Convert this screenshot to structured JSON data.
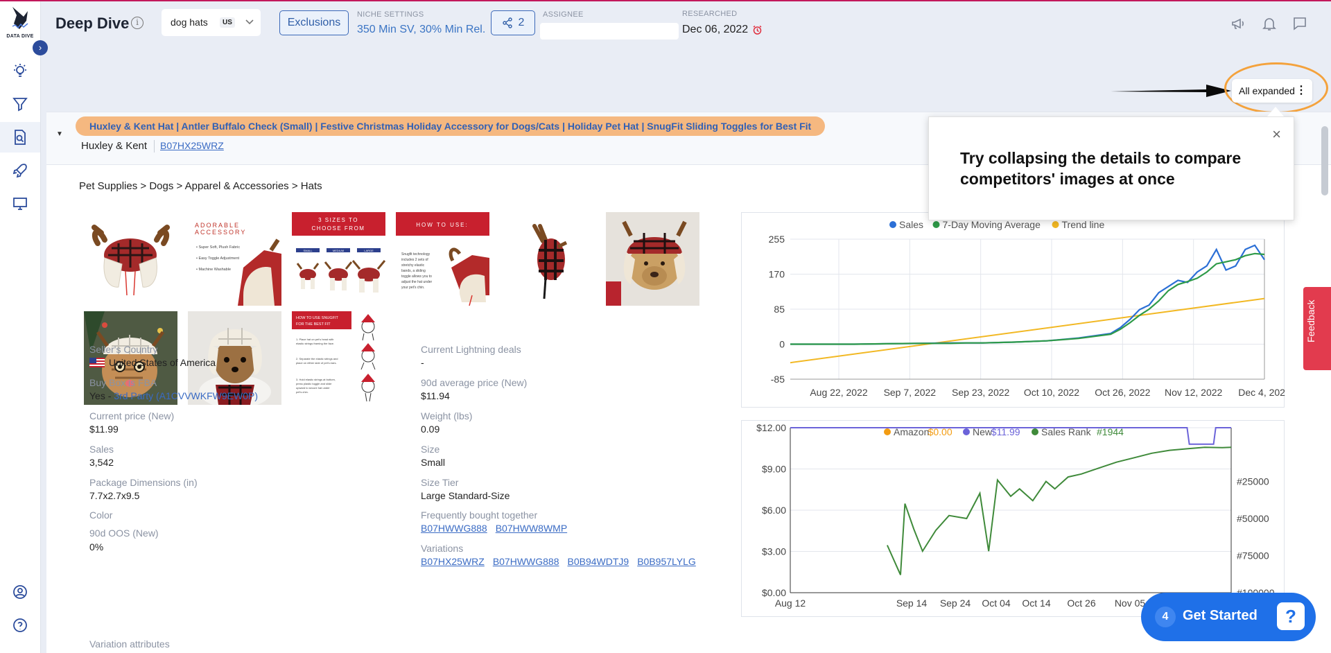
{
  "app": {
    "title": "Deep Dive",
    "logo_text": "DATA DIVE"
  },
  "header": {
    "keyword": "dog hats",
    "marketplace": "US",
    "exclusions_label": "Exclusions",
    "niche_settings_label": "NICHE SETTINGS",
    "niche_settings_value": "350 Min SV, 30% Min Rel.",
    "share_count": "2",
    "assignee_label": "ASSIGNEE",
    "assignee_value": "",
    "researched_label": "RESEARCHED",
    "researched_value": "Dec 06, 2022"
  },
  "toggle": {
    "label": "All expanded"
  },
  "tooltip": {
    "text": "Try collapsing the details to compare competitors' images at once",
    "close": "×"
  },
  "product": {
    "title": "Huxley & Kent Hat | Antler Buffalo Check (Small) | Festive Christmas Holiday Accessory for Dogs/Cats | Holiday Pet Hat | SnugFit Sliding Toggles for Best Fit",
    "brand": "Huxley & Kent",
    "asin": "B07HX25WRZ",
    "breadcrumb": "Pet Supplies > Dogs > Apparel & Accessories > Hats",
    "images": [
      {
        "name": "antler-hat-front"
      },
      {
        "name": "adorable-accessory",
        "caption": "ADORABLE ACCESSORY",
        "lines": [
          "Super Soft, Plush Fabric",
          "Easy Toggle Adjustment",
          "Machine Washable"
        ]
      },
      {
        "name": "three-sizes",
        "caption": "3 SIZES TO CHOOSE FROM",
        "sizes": [
          "SMALL",
          "MEDIUM",
          "LARGE"
        ]
      },
      {
        "name": "how-to-use",
        "caption": "HOW TO USE:",
        "lines": [
          "Snugfit technology",
          "includes 2 sets of",
          "stretchy elastic",
          "bands, a sliding",
          "toggle allows you to",
          "adjust the hat under",
          "your pet's chin."
        ]
      },
      {
        "name": "antler-hat-side"
      },
      {
        "name": "dog-wearing-hat"
      },
      {
        "name": "cat-wearing-hat"
      },
      {
        "name": "yorkie-wearing-hat"
      },
      {
        "name": "snugfit-guide",
        "caption": "HOW TO USE SNUGFIT FOR THE BEST FIT",
        "lines": [
          "1. Place hat on pet's head with elastic strings framing the face.",
          "2. Separate the elastic strings and place on either side of pet's ears.",
          "3. Hold elastic strings at bottom, press plastic toggle and slide upward to secure hat under pet's chin."
        ]
      }
    ],
    "left_details": [
      {
        "label": "Seller's Country",
        "value": "United States of America",
        "flag": "us-flag-icon"
      },
      {
        "label": "Buy Box is FBA",
        "value_prefix": "Yes - ",
        "value_link": "3rd Party (A1CVVWKFW9EW0P)"
      },
      {
        "label": "Current price (New)",
        "value": "$11.99"
      },
      {
        "label": "Sales",
        "value": "3,542"
      },
      {
        "label": "Package Dimensions (in)",
        "value": "7.7x2.7x9.5"
      },
      {
        "label": "Color",
        "value": ""
      },
      {
        "label": "90d OOS (New)",
        "value": "0%"
      },
      {
        "label": "Variation attributes",
        "value": ""
      }
    ],
    "right_details": [
      {
        "label": "Current Lightning deals",
        "value": "-"
      },
      {
        "label": "90d average price (New)",
        "value": "$11.94"
      },
      {
        "label": "Weight (lbs)",
        "value": "0.09"
      },
      {
        "label": "Size",
        "value": "Small"
      },
      {
        "label": "Size Tier",
        "value": "Large Standard-Size"
      },
      {
        "label": "Frequently bought together",
        "links": [
          "B07HWWG888",
          "B07HWW8WMP"
        ]
      },
      {
        "label": "Variations",
        "links": [
          "B07HX25WRZ",
          "B07HWWG888",
          "B0B94WDTJ9",
          "B0B957LYLG"
        ]
      }
    ]
  },
  "feedback": {
    "label": "Feedback"
  },
  "get_started": {
    "count": "4",
    "label": "Get Started"
  },
  "colors": {
    "accent": "#2c4c9c",
    "sales": "#2b6fd6",
    "moving_avg": "#2e9a48",
    "trend": "#f2b823",
    "amazon": "#f39c12",
    "new_price": "#6b63d9",
    "rank": "#3f8a3a"
  },
  "chart_data": [
    {
      "type": "line",
      "legend": [
        "Sales",
        "7-Day Moving Average",
        "Trend line"
      ],
      "x_ticks": [
        "Aug 22, 2022",
        "Sep 7, 2022",
        "Sep 23, 2022",
        "Oct 10, 2022",
        "Oct 26, 2022",
        "Nov 12, 2022",
        "Dec 4, 2022"
      ],
      "y_ticks": [
        255,
        170,
        85,
        0,
        -85
      ],
      "ylim": [
        -85,
        255
      ],
      "grid": true,
      "series": [
        {
          "name": "Sales",
          "x": [
            0,
            10,
            20,
            30,
            40,
            50,
            55,
            60,
            70,
            80,
            90,
            100,
            103,
            106,
            109,
            112,
            115,
            118,
            121,
            124,
            127,
            130,
            133,
            136,
            139,
            142,
            145,
            148
          ],
          "y": [
            0,
            0,
            0,
            1,
            2,
            3,
            3,
            3,
            5,
            8,
            15,
            26,
            40,
            60,
            84,
            95,
            125,
            140,
            155,
            150,
            175,
            190,
            230,
            180,
            190,
            230,
            240,
            205
          ]
        },
        {
          "name": "7-Day Moving Average",
          "x": [
            0,
            10,
            20,
            30,
            40,
            50,
            55,
            60,
            70,
            80,
            90,
            100,
            103,
            106,
            109,
            112,
            115,
            118,
            121,
            124,
            127,
            130,
            133,
            136,
            139,
            142,
            145,
            148
          ],
          "y": [
            0,
            0,
            0,
            1,
            2,
            2,
            3,
            3,
            5,
            8,
            14,
            24,
            36,
            52,
            70,
            85,
            105,
            130,
            145,
            152,
            160,
            175,
            195,
            200,
            205,
            215,
            220,
            218
          ]
        },
        {
          "name": "Trend line",
          "x": [
            0,
            148
          ],
          "y": [
            -45,
            111
          ]
        }
      ]
    },
    {
      "type": "line",
      "legend": [
        "Amazon $0.00",
        "New $11.99",
        "Sales Rank #1944"
      ],
      "x_ticks": [
        "Aug 12",
        "Sep 14",
        "Sep 24",
        "Oct 04",
        "Oct 14",
        "Oct 26",
        "Nov 05",
        "No"
      ],
      "y_ticks_left": [
        "$12.00",
        "$9.00",
        "$6.00",
        "$3.00",
        "$0.00"
      ],
      "y_ticks_right": [
        "#25000",
        "#50000",
        "#75000",
        "#100000"
      ],
      "ylim": [
        0,
        12
      ],
      "y2lim": [
        100000,
        0
      ],
      "series": [
        {
          "name": "New",
          "x": [
            0,
            90,
            90.5,
            96,
            96.5,
            100
          ],
          "y": [
            12,
            12,
            10.8,
            10.8,
            12,
            12
          ]
        },
        {
          "name": "Sales Rank",
          "x": [
            22,
            25,
            26,
            28,
            30,
            33,
            36,
            40,
            43,
            45,
            47,
            50,
            52,
            55,
            58,
            60,
            63,
            66,
            70,
            74,
            78,
            82,
            86,
            90,
            94,
            98,
            100
          ],
          "y": [
            68000,
            88000,
            40000,
            57000,
            72000,
            58000,
            48000,
            50000,
            33000,
            72000,
            24000,
            35000,
            30000,
            38000,
            25000,
            30000,
            22000,
            20000,
            16000,
            12000,
            9000,
            6000,
            4000,
            3000,
            1944,
            2200,
            1944
          ]
        }
      ]
    }
  ]
}
